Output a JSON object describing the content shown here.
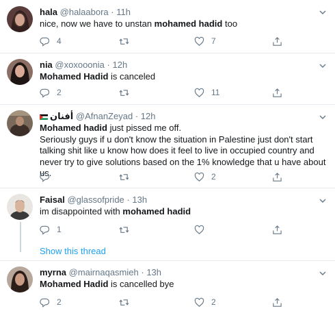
{
  "tweets": [
    {
      "name": "hala",
      "handle": "@halaabora",
      "sep": "·",
      "time": "11h",
      "body_pre": "nice, now we have to unstan ",
      "body_bold": "mohamed hadid",
      "body_post": " too",
      "replies": "4",
      "retweets": "",
      "likes": "7"
    },
    {
      "name": "nia",
      "handle": "@xoxooonia",
      "sep": "·",
      "time": "12h",
      "body_bold": "Mohamed Hadid",
      "body_post": " is canceled",
      "replies": "2",
      "retweets": "",
      "likes": "11"
    },
    {
      "name": "أفنان",
      "handle": "@AfnanZeyad",
      "sep": "·",
      "time": "12h",
      "body_bold": "Mohamed hadid",
      "body_post": " just pissed me off.",
      "body_line2": "Seriously guys if u don't know the situation in Palestine just don't start talking shit like u know how does it feel to live in occupied country and never try to give solutions based on the 1% knowledge that u have about us.",
      "replies": "",
      "retweets": "",
      "likes": "2"
    },
    {
      "name": "Faisal",
      "handle": "@glassofpride",
      "sep": "·",
      "time": "13h",
      "body_pre": "im disappointed with ",
      "body_bold": "mohamed hadid",
      "replies": "1",
      "retweets": "",
      "likes": "",
      "show_thread": "Show this thread"
    },
    {
      "name": "myrna",
      "handle": "@mairnaqasmieh",
      "sep": "·",
      "time": "13h",
      "body_bold": "Mohamed Hadid",
      "body_post": " is cancelled bye",
      "replies": "2",
      "retweets": "",
      "likes": "2"
    }
  ],
  "icons": {
    "reply": "reply-icon",
    "retweet": "retweet-icon",
    "like": "heart-icon",
    "share": "share-icon",
    "caret": "chevron-down-icon"
  },
  "colors": {
    "text": "#14171a",
    "secondary": "#657786",
    "link": "#1da1f2",
    "divider": "#e6ecf0"
  }
}
